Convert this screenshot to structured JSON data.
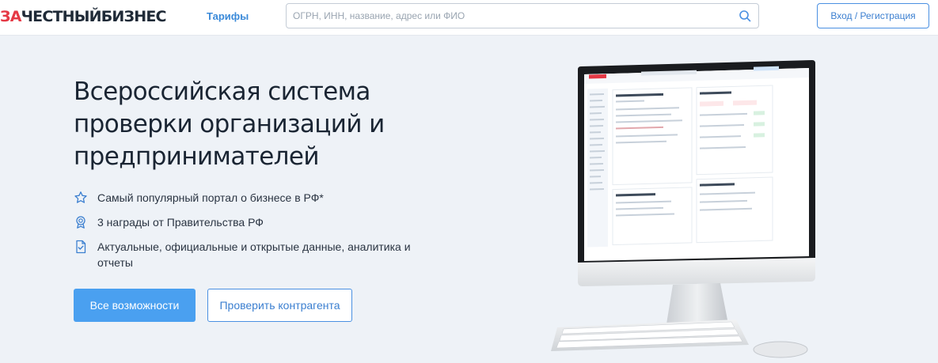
{
  "header": {
    "logo_accent": "ЗА",
    "logo_rest": "ЧЕСТНЫЙБИЗНЕС",
    "nav_tariffs": "Тарифы",
    "search_placeholder": "ОГРН, ИНН, название, адрес или ФИО",
    "login_label": "Вход / Регистрация"
  },
  "hero": {
    "title": "Всероссийская система проверки организаций и предпринимателей",
    "features": [
      {
        "icon": "star-icon",
        "text": "Самый популярный портал о бизнесе в РФ*"
      },
      {
        "icon": "award-medal-icon",
        "text": "3 награды от Правительства РФ"
      },
      {
        "icon": "document-check-icon",
        "text": "Актуальные, официальные и открытые данные, аналитика и отчеты"
      }
    ],
    "primary_button": "Все возможности",
    "secondary_button": "Проверить контрагента"
  },
  "colors": {
    "accent_red": "#e53945",
    "primary_blue": "#4aa0f0",
    "link_blue": "#3b8ad9",
    "background": "#eef2f7"
  }
}
